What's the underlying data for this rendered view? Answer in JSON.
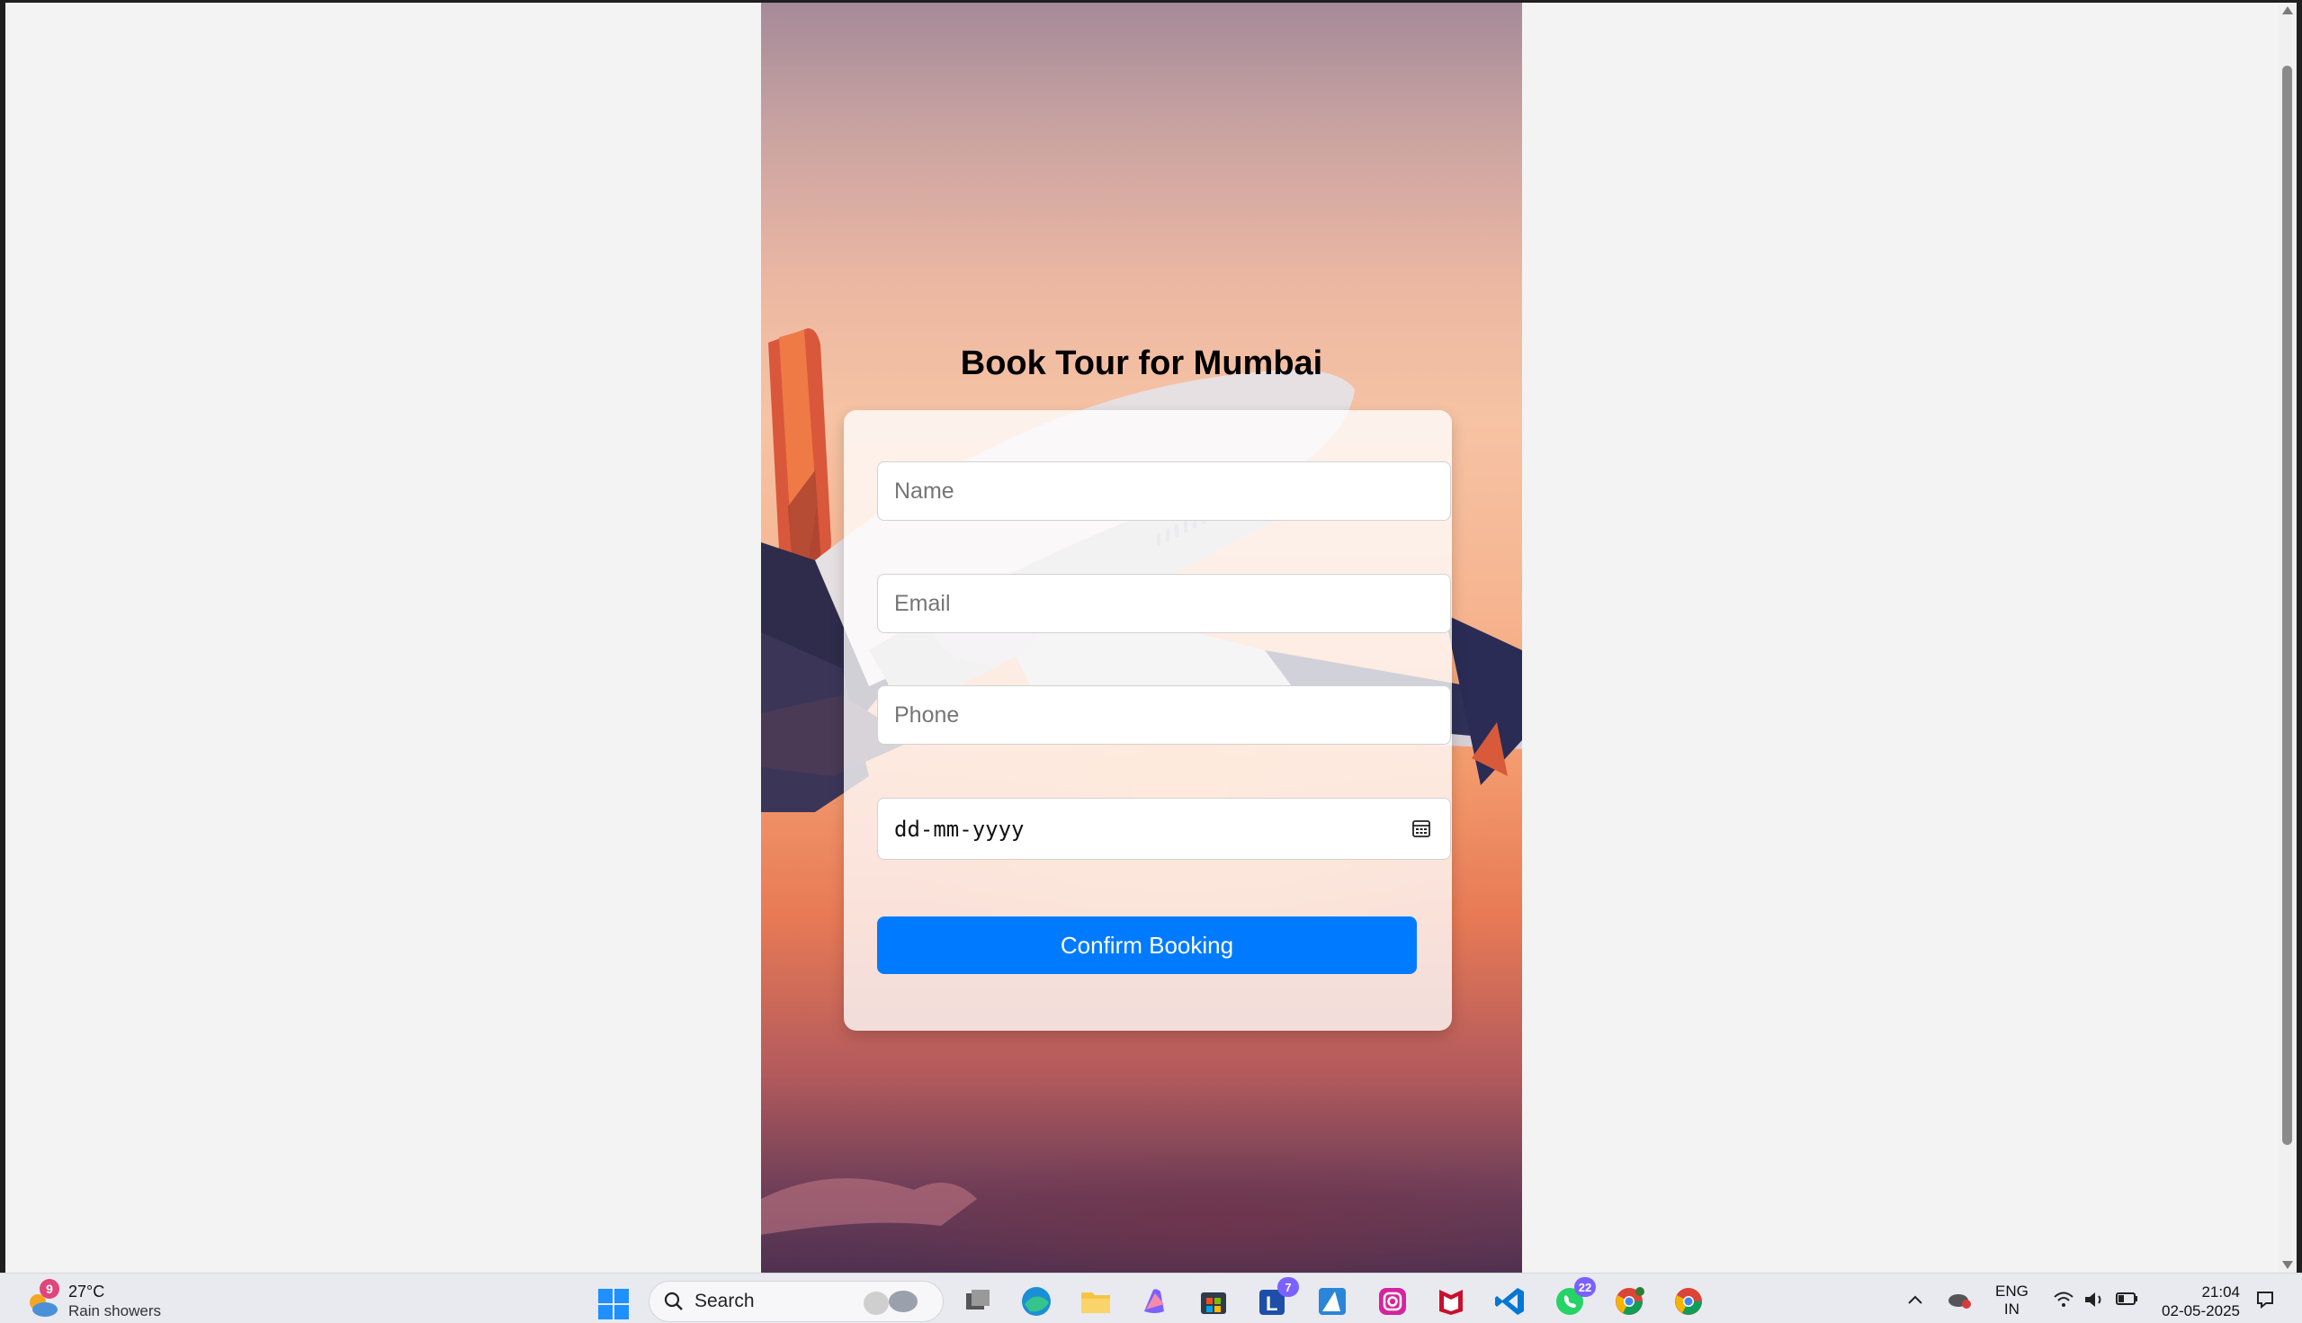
{
  "page": {
    "title": "Book Tour for Mumbai"
  },
  "form": {
    "name_placeholder": "Name",
    "email_placeholder": "Email",
    "phone_placeholder": "Phone",
    "date_placeholder": "dd-mm-yyyy",
    "submit_label": "Confirm Booking"
  },
  "colors": {
    "button": "#007bff",
    "page_background": "#f3f3f3"
  },
  "taskbar": {
    "weather_badge": "9",
    "weather_temp": "27°C",
    "weather_desc": "Rain showers",
    "search_label": "Search",
    "teams_badge": "7",
    "whatsapp_badge": "22",
    "language": "ENG",
    "region": "IN",
    "time": "21:04",
    "date": "02-05-2025",
    "icons": [
      "windows-start-icon",
      "search-icon",
      "task-view-icon",
      "edge-icon",
      "file-explorer-icon",
      "copilot-icon",
      "microsoft-store-icon",
      "teams-icon",
      "azure-icon",
      "instagram-icon",
      "mcafee-icon",
      "vscode-icon",
      "whatsapp-icon",
      "chrome-profile-icon",
      "chrome-icon"
    ]
  }
}
